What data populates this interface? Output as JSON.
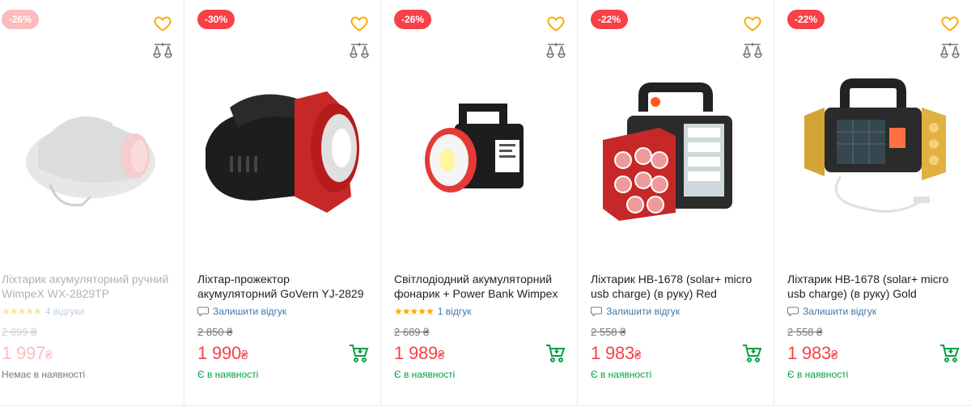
{
  "colors": {
    "accent": "#00a046",
    "sale": "#f84147",
    "star": "#ffa900",
    "link": "#3e77aa",
    "wish": "#ffa900"
  },
  "icons": {
    "wishlist": "heart-icon",
    "compare": "scales-icon",
    "cart": "cart-icon",
    "review": "speech-bubble-icon",
    "rating": "star-icon"
  },
  "products": [
    {
      "badge": "-26%",
      "title": "Ліхтарик акумуляторний ручний WimpeX WX-2829TP",
      "stars": "★★★★★",
      "reviews": "4 відгуки",
      "old_price": "2 699 ₴",
      "price": "1 997",
      "currency": "₴",
      "status": "Немає в наявності"
    },
    {
      "badge": "-30%",
      "title": "Ліхтар-прожектор акумуляторний GoVern YJ-2829",
      "stars": "",
      "reviews": "Залишити відгук",
      "old_price": "2 850 ₴",
      "price": "1 990",
      "currency": "₴",
      "status": "Є в наявності"
    },
    {
      "badge": "-26%",
      "title": "Світлодіодний акумуляторний фонарик + Power Bank Wimpex",
      "stars": "★★★★★",
      "reviews": "1 відгук",
      "old_price": "2 689 ₴",
      "price": "1 989",
      "currency": "₴",
      "status": "Є в наявності"
    },
    {
      "badge": "-22%",
      "title": "Ліхтарик HB-1678 (solar+ micro usb charge) (в руку) Red",
      "stars": "",
      "reviews": "Залишити відгук",
      "old_price": "2 558 ₴",
      "price": "1 983",
      "currency": "₴",
      "status": "Є в наявності"
    },
    {
      "badge": "-22%",
      "title": "Ліхтарик HB-1678 (solar+ micro usb charge) (в руку) Gold",
      "stars": "",
      "reviews": "Залишити відгук",
      "old_price": "2 558 ₴",
      "price": "1 983",
      "currency": "₴",
      "status": "Є в наявності"
    }
  ]
}
